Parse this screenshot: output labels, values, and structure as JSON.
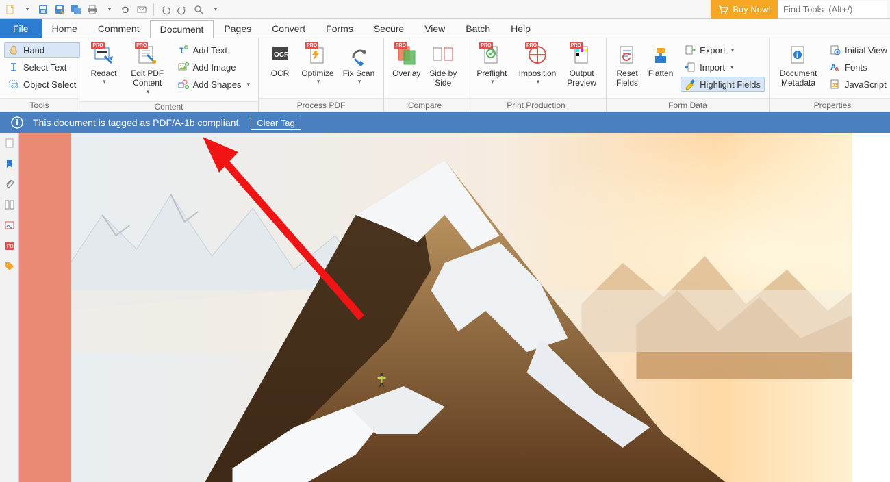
{
  "qat": {
    "buy_now": "Buy Now!",
    "find_placeholder": "Find Tools  (Alt+/)"
  },
  "menu": {
    "file": "File",
    "home": "Home",
    "comment": "Comment",
    "document": "Document",
    "pages": "Pages",
    "convert": "Convert",
    "forms": "Forms",
    "secure": "Secure",
    "view": "View",
    "batch": "Batch",
    "help": "Help"
  },
  "tools": {
    "group": "Tools",
    "hand": "Hand",
    "select_text": "Select Text",
    "object_select": "Object Select"
  },
  "content": {
    "group": "Content",
    "redact": "Redact",
    "edit_pdf": "Edit PDF Content",
    "add_text": "Add Text",
    "add_image": "Add Image",
    "add_shapes": "Add Shapes"
  },
  "process": {
    "group": "Process PDF",
    "ocr": "OCR",
    "optimize": "Optimize",
    "fix_scan": "Fix Scan"
  },
  "compare": {
    "group": "Compare",
    "overlay": "Overlay",
    "side_by_side": "Side by Side"
  },
  "print_prod": {
    "group": "Print Production",
    "preflight": "Preflight",
    "imposition": "Imposition",
    "output_preview": "Output Preview"
  },
  "form_data": {
    "group": "Form Data",
    "reset_fields": "Reset Fields",
    "flatten": "Flatten",
    "export": "Export",
    "import": "Import",
    "highlight_fields": "Highlight Fields"
  },
  "properties": {
    "group": "Properties",
    "doc_metadata": "Document Metadata",
    "initial_view": "Initial View",
    "fonts": "Fonts",
    "javascript": "JavaScript"
  },
  "infobar": {
    "message": "This document is tagged as PDF/A-1b compliant.",
    "clear_tag": "Clear Tag"
  }
}
